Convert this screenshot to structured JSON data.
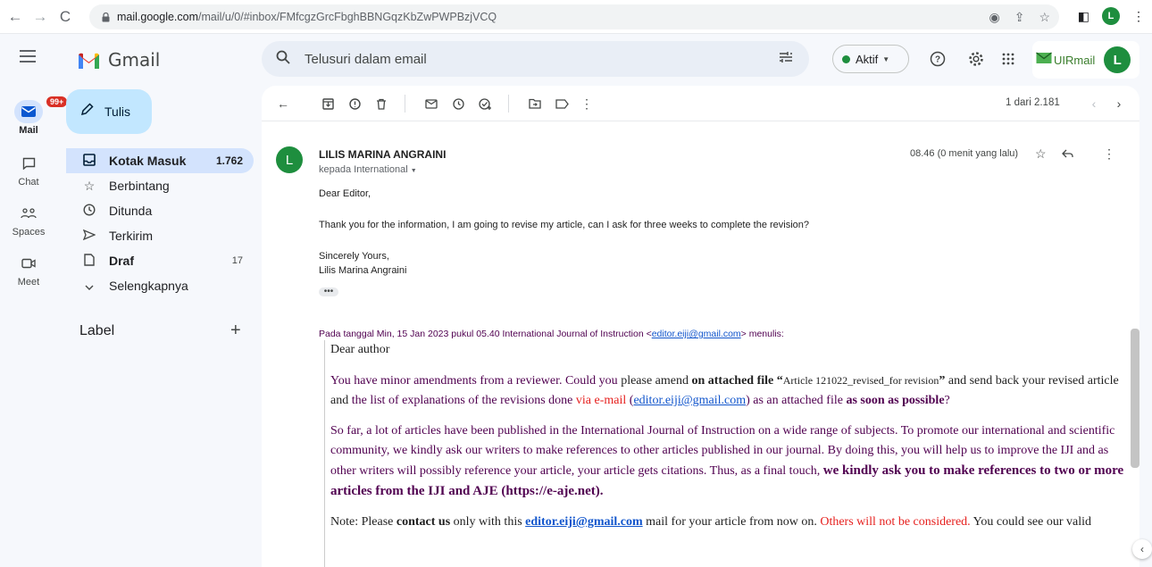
{
  "browser": {
    "url_host": "mail.google.com",
    "url_path": "/mail/u/0/#inbox/FMfcgzGrcFbghBBNGqzKbZwPWPBzjVCQ",
    "profile_initial": "L"
  },
  "app": {
    "logo_text": "Gmail",
    "search_placeholder": "Telusuri dalam email",
    "status_label": "Aktif",
    "account_brand": "UIRmail",
    "account_initial": "L"
  },
  "rail": {
    "items": [
      {
        "label": "Mail",
        "badge": "99+"
      },
      {
        "label": "Chat"
      },
      {
        "label": "Spaces"
      },
      {
        "label": "Meet"
      }
    ]
  },
  "sidebar": {
    "compose_label": "Tulis",
    "folders": [
      {
        "label": "Kotak Masuk",
        "count": "1.762"
      },
      {
        "label": "Berbintang",
        "count": ""
      },
      {
        "label": "Ditunda",
        "count": ""
      },
      {
        "label": "Terkirim",
        "count": ""
      },
      {
        "label": "Draf",
        "count": "17"
      },
      {
        "label": "Selengkapnya",
        "count": ""
      }
    ],
    "label_header": "Label"
  },
  "toolbar": {
    "pager": "1 dari 2.181"
  },
  "message": {
    "sender_initial": "L",
    "sender_name": "LILIS MARINA ANGRAINI",
    "recipient": "kepada International",
    "time": "08.46 (0 menit yang lalu)",
    "greeting": "Dear Editor,",
    "body": "Thank you for the information, I am going to revise my article, can I ask for three weeks to complete the revision?",
    "signoff": "Sincerely Yours,",
    "signature": "Lilis Marina Angraini",
    "dots": "•••"
  },
  "quote": {
    "intro_pre": "Pada tanggal Min, 15 Jan 2023 pukul 05.40 International Journal of Instruction <",
    "intro_email": "editor.eiji@gmail.com",
    "intro_post": "> menulis:",
    "salutation": "Dear author",
    "p1_a": "You have minor amendments from a reviewer. Could you ",
    "p1_b": "please amend ",
    "p1_c": "on attached file “",
    "p1_file": "Article 121022_revised_for revision",
    "p1_d": "” ",
    "p1_e": "and send back your revised article and ",
    "p1_f": "the list of explanations of the revisions done ",
    "p1_g": "via e-mail",
    "p1_h": " (",
    "p1_email": "editor.eiji@gmail.com",
    "p1_i": ") as an attached file ",
    "p1_j": "as soon as possible",
    "p1_k": "?",
    "p2_a": "So far, a lot of articles have been published in the International Journal of Instruction on a wide range of subjects. To promote our international and scientific community, we kindly ask our writers to make references to other articles published in our journal. By doing this, you will help us to improve the IJI and as other writers will possibly reference your article, your article gets citations. Thus, as a final touch, ",
    "p2_b": "we kindly ask you to make references to two or more articles from the IJI and AJE (https://e-aje.net).",
    "p3_a": "Note: Please ",
    "p3_b": "contact us",
    "p3_c": " only with this ",
    "p3_email": "editor.eiji@gmail.com",
    "p3_d": " mail for your article from now on. ",
    "p3_e": "Others will not be considered.",
    "p3_f": " You could see our valid"
  }
}
